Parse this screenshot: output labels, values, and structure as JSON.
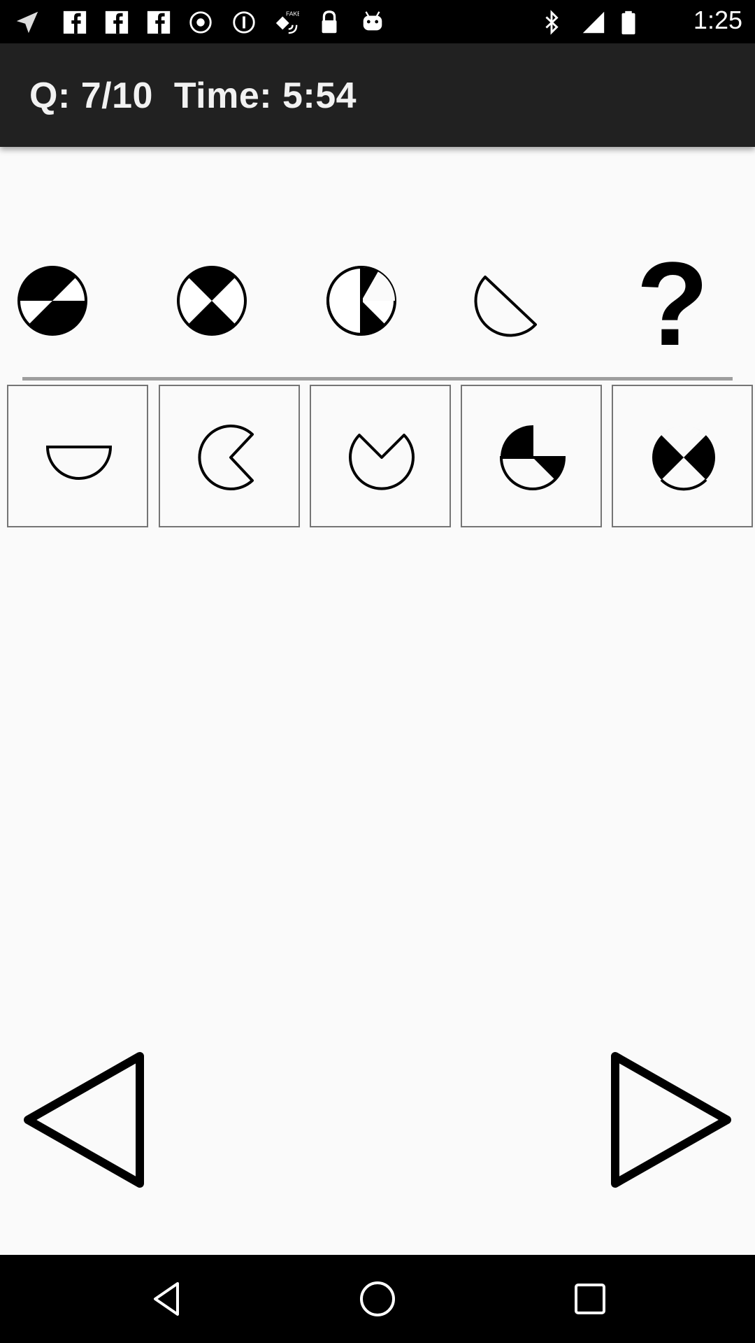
{
  "status_bar": {
    "time": "1:25",
    "icons": [
      "send-icon",
      "facebook-icon",
      "facebook-icon",
      "facebook-icon",
      "record-icon",
      "info-icon",
      "fake-gps-icon",
      "lock-icon",
      "android-icon",
      "bluetooth-icon",
      "signal-icon",
      "battery-icon"
    ]
  },
  "header": {
    "title": "Q: 7/10  Time: 5:54"
  },
  "sequence": {
    "items": [
      "pie-figure-1",
      "pie-figure-2",
      "pie-figure-3",
      "pie-figure-4"
    ],
    "unknown": "?"
  },
  "options": [
    "option-half-circle",
    "option-pacman",
    "option-circle-notch",
    "option-half-filled",
    "option-two-wedges"
  ],
  "navigation": {
    "previous": "previous-arrow-icon",
    "next": "next-arrow-icon"
  },
  "system_nav": [
    "back-icon",
    "home-icon",
    "recents-icon"
  ]
}
